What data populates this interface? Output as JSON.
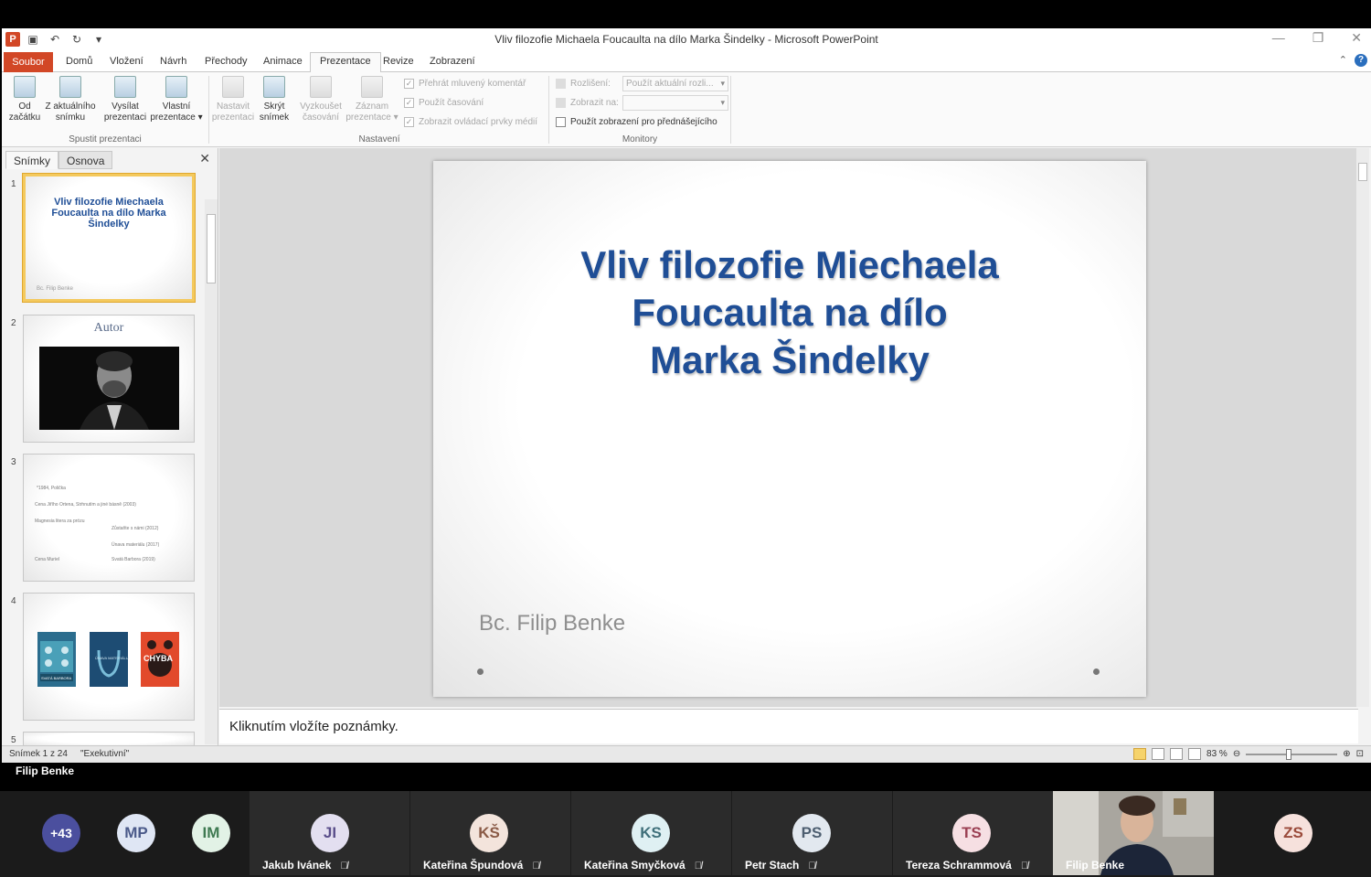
{
  "window": {
    "title": "Vliv filozofie Michaela Foucaulta na dílo Marka Šindelky  -  Microsoft PowerPoint",
    "app_icon": "P"
  },
  "ribbon_tabs": [
    "Soubor",
    "Domů",
    "Vložení",
    "Návrh",
    "Přechody",
    "Animace",
    "Prezentace",
    "Revize",
    "Zobrazení"
  ],
  "active_tab": "Prezentace",
  "ribbon": {
    "group_start": {
      "label": "Spustit prezentaci",
      "buttons": [
        {
          "line1": "Od",
          "line2": "začátku"
        },
        {
          "line1": "Z aktuálního",
          "line2": "snímku"
        },
        {
          "line1": "Vysílat",
          "line2": "prezentaci"
        },
        {
          "line1": "Vlastní",
          "line2": "prezentace ▾"
        }
      ]
    },
    "group_setup": {
      "label": "Nastavení",
      "buttons": [
        {
          "line1": "Nastavit",
          "line2": "prezentaci"
        },
        {
          "line1": "Skrýt",
          "line2": "snímek"
        },
        {
          "line1": "Vyzkoušet",
          "line2": "časování"
        },
        {
          "line1": "Záznam",
          "line2": "prezentace ▾"
        }
      ],
      "checks": [
        "Přehrát mluvený komentář",
        "Použít časování",
        "Zobrazit ovládací prvky médií"
      ]
    },
    "group_monitors": {
      "label": "Monitory",
      "resolution_label": "Rozlišení:",
      "resolution_value": "Použít aktuální rozli...",
      "show_on_label": "Zobrazit na:",
      "show_on_value": "",
      "presenter_view": "Použít zobrazení pro přednášejícího"
    }
  },
  "left_pane": {
    "tabs": [
      "Snímky",
      "Osnova"
    ],
    "slides": [
      {
        "num": "1",
        "title": "Vliv filozofie Miechaela Foucaulta na dílo Marka Šindelky",
        "subtitle": "Bc. Filip Benke"
      },
      {
        "num": "2",
        "title": "Autor"
      },
      {
        "num": "3",
        "lines": [
          "*1984, Polička",
          "Cena Jiřího Ortena, Strhnutím a jiné básně (2003)",
          "Magnesia litera za prózu",
          "Zůstaňte s námi   (2012)",
          "Únava materiálu  (2017)",
          "Cena Muriel",
          "Svatá Barbora    (2019)"
        ]
      },
      {
        "num": "4",
        "books": [
          "SVATÁ BARBORA",
          "ÚNAVA MATERIÁLU",
          "CHYBA"
        ]
      },
      {
        "num": "5"
      }
    ]
  },
  "slide": {
    "title_lines": [
      "Vliv filozofie Miechaela",
      "Foucaulta na dílo",
      "Marka Šindelky"
    ],
    "subtitle": "Bc. Filip Benke"
  },
  "notes_placeholder": "Kliknutím vložíte poznámky.",
  "status": {
    "slide_pos": "Snímek 1 z 24",
    "theme": "\"Exekutivní\"",
    "zoom": "83 %"
  },
  "meeting": {
    "speaker": "Filip Benke",
    "more_count": "+43",
    "participants": [
      {
        "initials": "MP",
        "name": ""
      },
      {
        "initials": "IM",
        "name": ""
      },
      {
        "initials": "JI",
        "name": "Jakub Ivánek"
      },
      {
        "initials": "KŠ",
        "name": "Kateřina Špundová"
      },
      {
        "initials": "KS",
        "name": "Kateřina Smyčková"
      },
      {
        "initials": "PS",
        "name": "Petr Stach"
      },
      {
        "initials": "TS",
        "name": "Tereza Schrammová"
      },
      {
        "initials": "",
        "name": "Filip Benke"
      },
      {
        "initials": "ZS",
        "name": ""
      }
    ]
  }
}
